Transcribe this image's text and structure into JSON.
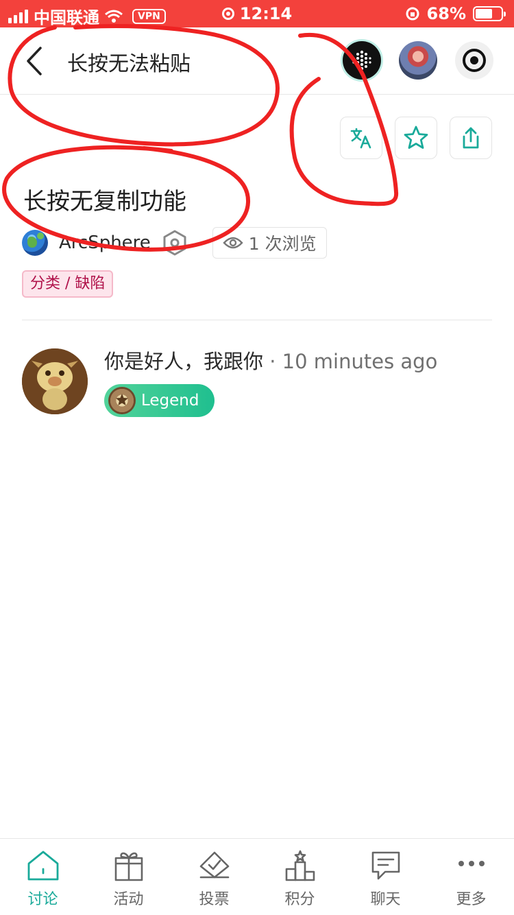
{
  "status_bar": {
    "carrier": "中国联通",
    "vpn": "VPN",
    "time": "12:14",
    "battery_percent": "68%",
    "battery_level": 0.68
  },
  "header": {
    "title": "长按无法粘贴",
    "icons": [
      "back-arrow-icon",
      "dots-logo-icon",
      "avatar",
      "record-icon"
    ]
  },
  "actions": [
    "translate-icon",
    "star-icon",
    "share-icon"
  ],
  "topic": {
    "title": "长按无复制功能",
    "author": "ArcSphere",
    "views": "1 次浏览",
    "tag": "分类 / 缺陷"
  },
  "post": {
    "author": "你是好人，我跟你",
    "separator": "·",
    "time": "10 minutes ago",
    "badge": "Legend"
  },
  "tabbar": {
    "items": [
      {
        "label": "讨论",
        "icon": "home-icon",
        "active": true
      },
      {
        "label": "活动",
        "icon": "gift-icon",
        "active": false
      },
      {
        "label": "投票",
        "icon": "vote-box-icon",
        "active": false
      },
      {
        "label": "积分",
        "icon": "podium-icon",
        "active": false
      },
      {
        "label": "聊天",
        "icon": "chat-icon",
        "active": false
      },
      {
        "label": "更多",
        "icon": "more-dots-icon",
        "active": false
      }
    ]
  },
  "colors": {
    "status_bar": "#f3413c",
    "accent": "#1aaa9a",
    "tag_text": "#b0124a",
    "annotation": "#ee2222"
  }
}
